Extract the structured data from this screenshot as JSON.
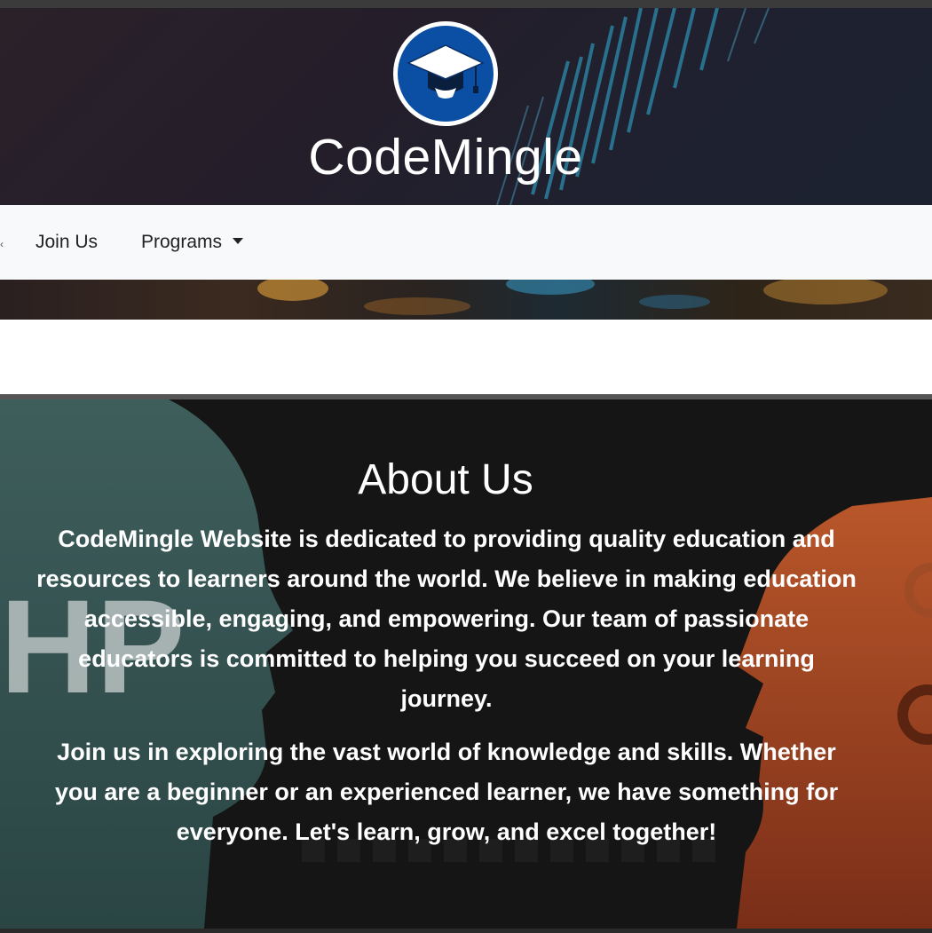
{
  "header": {
    "logo_icon": "graduation-cap-icon",
    "brand_name": "CodeMingle"
  },
  "nav": {
    "items": [
      {
        "label": "Join Us"
      },
      {
        "label": "Programs",
        "dropdown": true
      }
    ]
  },
  "about": {
    "title": "About Us",
    "paragraphs": [
      "CodeMingle Website is dedicated to providing quality education and resources to learners around the world. We believe in making education accessible, engaging, and empowering. Our team of passionate educators is committed to helping you succeed on your learning journey.",
      "Join us in exploring the vast world of knowledge and skills. Whether you are a beginner or an experienced learner, we have something for everyone. Let's learn, grow, and excel together!"
    ]
  },
  "colors": {
    "logo_blue": "#0b4fa5",
    "navbar_bg": "#f8f9fa",
    "about_text": "#ffffff"
  }
}
